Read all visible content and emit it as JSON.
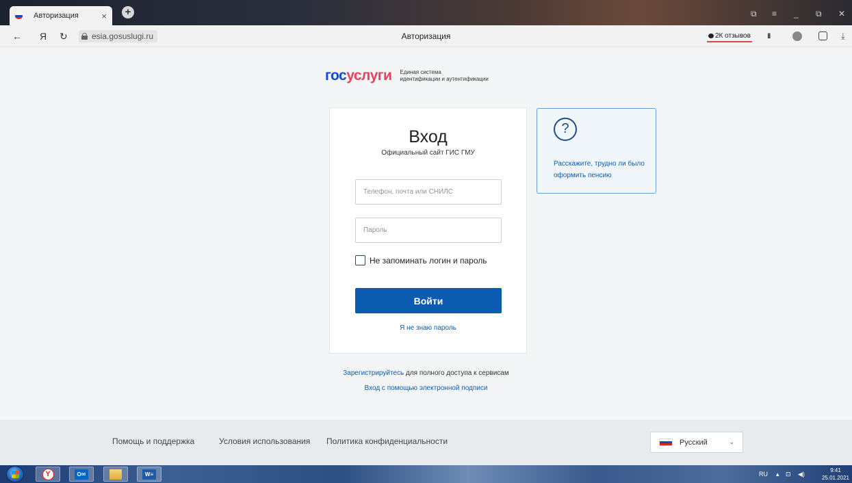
{
  "browser": {
    "tab": {
      "title": "Авторизация",
      "close": "×"
    },
    "new_tab": "+",
    "window_controls": {
      "tabs_menu": "⧉",
      "menu": "≡",
      "minimize": "_",
      "restore": "⧉",
      "close": "✕"
    },
    "address": {
      "back": "←",
      "yandex": "Я",
      "reload": "↻",
      "url": "esia.gosuslugi.ru",
      "page_title": "Авторизация",
      "reviews": "2К отзывов",
      "bookmark": "▮",
      "download": "⤓"
    }
  },
  "logo": {
    "gos": "гос",
    "uslugi": "услуги",
    "subtitle_line1": "Единая система",
    "subtitle_line2": "идентификации и аутентификации"
  },
  "login": {
    "title": "Вход",
    "subtitle": "Официальный сайт ГИС ГМУ",
    "login_placeholder": "Телефон, почта или СНИЛС",
    "password_placeholder": "Пароль",
    "remember_label": "Не запоминать логин и пароль",
    "submit_label": "Войти",
    "forgot_link": "Я не знаю пароль"
  },
  "help_card": {
    "icon": "?",
    "text": "Расскажите, трудно ли было оформить пенсию"
  },
  "register": {
    "link": "Зарегистрируйтесь",
    "rest": " для полного доступа к сервисам",
    "esign_link": "Вход с помощью электронной подписи"
  },
  "footer": {
    "help": "Помощь и поддержка",
    "terms": "Условия использования",
    "privacy": "Политика конфиденциальности",
    "language": "Русский",
    "language_chevron": "⌄"
  },
  "taskbar": {
    "yandex_letter": "Y",
    "outlook_label": "O✉",
    "word_label": "W≡",
    "lang": "RU",
    "tray_arrow": "▴",
    "network": "⊡",
    "volume": "◀)",
    "time": "9:41",
    "date": "25.01.2021"
  },
  "colors": {
    "brand_blue": "#0d4cd3",
    "brand_red": "#ee3f58",
    "button_blue": "#0b5cb0",
    "page_bg": "#f4f5f7"
  }
}
